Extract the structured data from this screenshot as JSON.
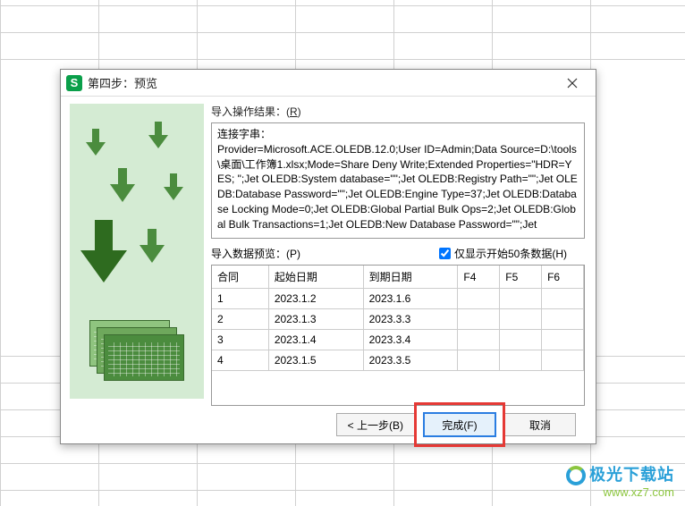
{
  "dialog": {
    "title": "第四步：预览",
    "result_label_prefix": "导入操作结果：(",
    "result_label_key": "R",
    "result_label_suffix": ")",
    "result_text_lines": [
      "连接字串：",
      "Provider=Microsoft.ACE.OLEDB.12.0;User ID=Admin;Data Source=D:\\tools\\桌面\\工作簿1.xlsx;Mode=Share Deny Write;Extended Properties=\"HDR=YES; \";Jet OLEDB:System database=\"\";Jet OLEDB:Registry Path=\"\";Jet OLEDB:Database Password=\"\";Jet OLEDB:Engine Type=37;Jet OLEDB:Database Locking Mode=0;Jet OLEDB:Global Partial Bulk Ops=2;Jet OLEDB:Global Bulk Transactions=1;Jet OLEDB:New Database Password=\"\";Jet"
    ],
    "preview_label_prefix": "导入数据预览：(",
    "preview_label_key": "P",
    "preview_label_suffix": ")",
    "checkbox_label_prefix": "仅显示开始50条数据(",
    "checkbox_label_key": "H",
    "checkbox_label_suffix": ")",
    "checkbox_checked": true,
    "table": {
      "headers": [
        "合同",
        "起始日期",
        "到期日期",
        "F4",
        "F5",
        "F6"
      ],
      "rows": [
        [
          "1",
          "2023.1.2",
          "2023.1.6",
          "",
          "",
          ""
        ],
        [
          "2",
          "2023.1.3",
          "2023.3.3",
          "",
          "",
          ""
        ],
        [
          "3",
          "2023.1.4",
          "2023.3.4",
          "",
          "",
          ""
        ],
        [
          "4",
          "2023.1.5",
          "2023.3.5",
          "",
          "",
          ""
        ]
      ]
    },
    "buttons": {
      "back": "< 上一步(B)",
      "finish": "完成(F)",
      "cancel": "取消"
    }
  },
  "watermark": {
    "brand": "极光下载站",
    "url": "www.xz7.com"
  }
}
